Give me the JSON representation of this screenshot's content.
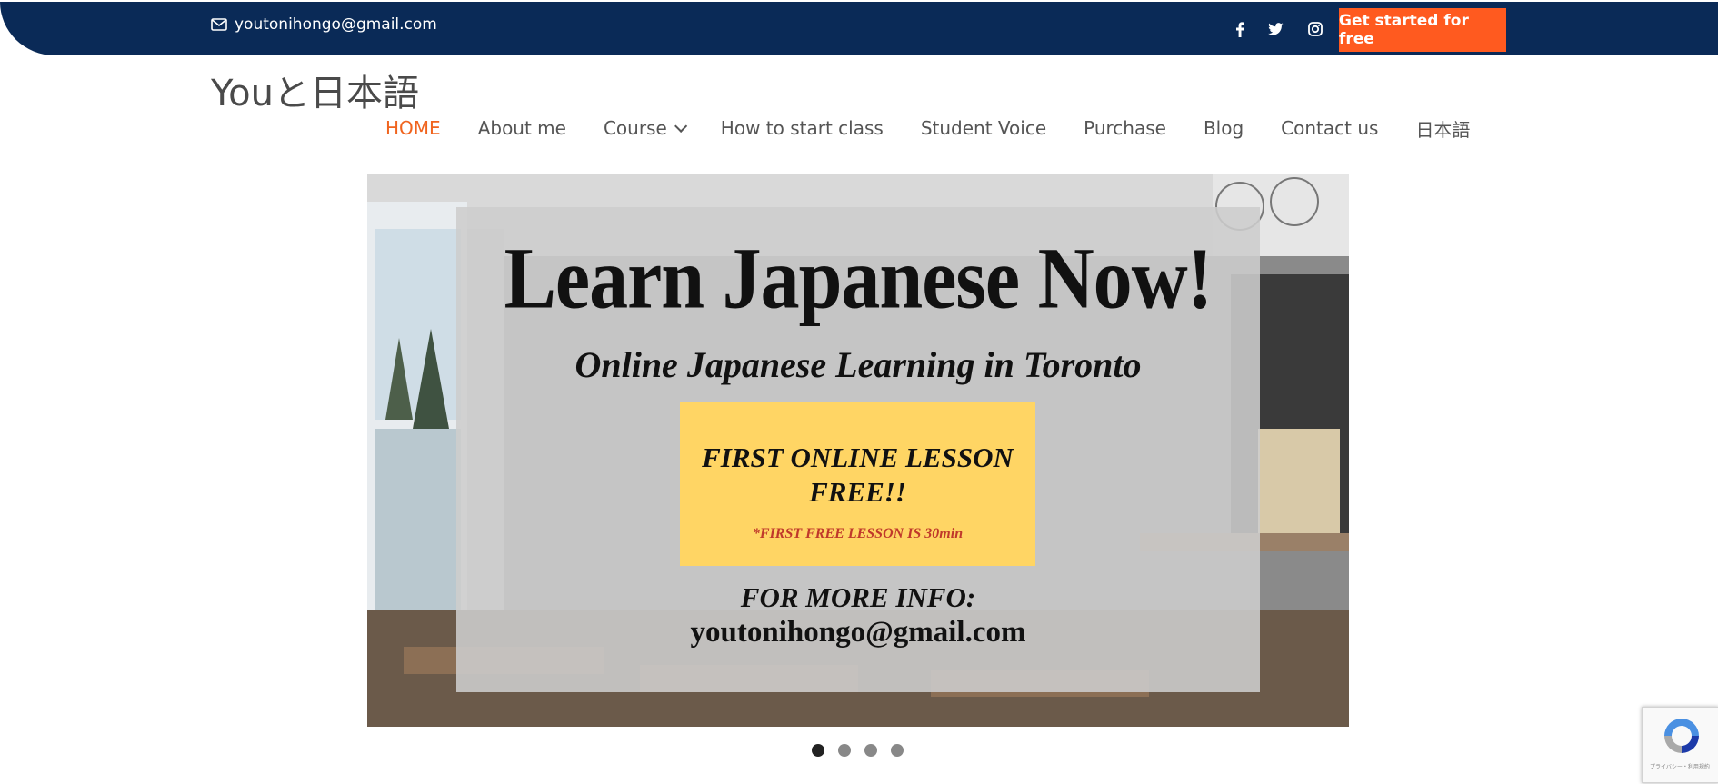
{
  "topbar": {
    "email": "youtonihongo@gmail.com",
    "cta_label": "Get started for free",
    "social": [
      "facebook-icon",
      "twitter-icon",
      "instagram-icon"
    ]
  },
  "site": {
    "logo": "Youと日本語"
  },
  "nav": {
    "items": [
      {
        "label": "HOME",
        "active": true
      },
      {
        "label": "About me"
      },
      {
        "label": "Course",
        "has_dropdown": true
      },
      {
        "label": "How to start class"
      },
      {
        "label": "Student Voice"
      },
      {
        "label": "Purchase"
      },
      {
        "label": "Blog"
      },
      {
        "label": "Contact us"
      },
      {
        "label": "日本語"
      }
    ]
  },
  "slider": {
    "title": "Learn Japanese Now!",
    "subtitle": "Online Japanese Learning in Toronto",
    "offer_line1": "FIRST ONLINE LESSON",
    "offer_line2": "FREE!!",
    "offer_note": "*FIRST FREE LESSON IS 30min",
    "info_label": "FOR MORE INFO:",
    "info_email": "youtonihongo@gmail.com",
    "total_slides": 4,
    "active_slide": 1
  },
  "recaptcha": {
    "text": "プライバシー・利用規約"
  },
  "colors": {
    "topbar": "#0a2a57",
    "accent": "#ff5a1f",
    "nav_active": "#f0641e",
    "banner_yellow": "#ffd564"
  }
}
